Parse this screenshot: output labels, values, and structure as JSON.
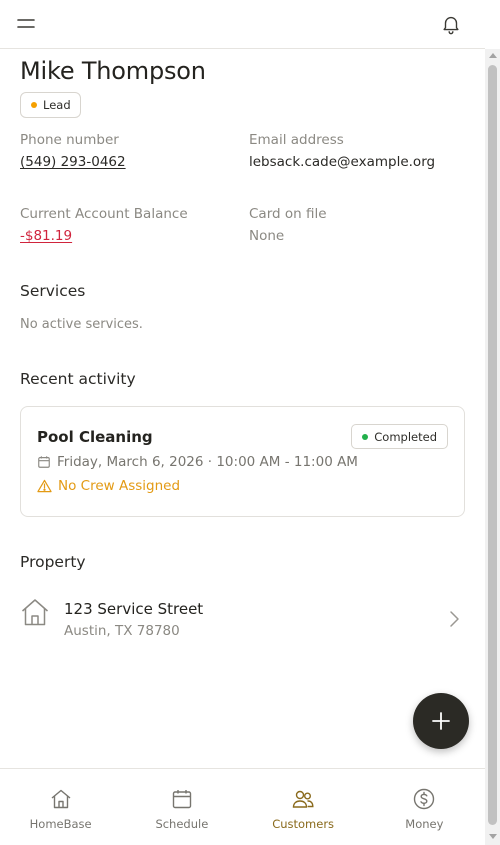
{
  "customer": {
    "name": "Mike Thompson",
    "status_badge": "Lead",
    "status_color": "#f5a000"
  },
  "fields": {
    "phone_label": "Phone number",
    "phone_value": "(549) 293-0462",
    "email_label": "Email address",
    "email_value": "lebsack.cade@example.org",
    "balance_label": "Current Account Balance",
    "balance_value": "-$81.19",
    "card_label": "Card on file",
    "card_value": "None"
  },
  "services": {
    "title": "Services",
    "empty_text": "No active services."
  },
  "activity": {
    "title": "Recent activity",
    "items": [
      {
        "title": "Pool Cleaning",
        "status": "Completed",
        "status_color": "#22b04b",
        "datetime": "Friday, March 6, 2026 · 10:00 AM - 11:00 AM",
        "warning": "No Crew Assigned",
        "warning_color": "#e39a14"
      }
    ]
  },
  "property": {
    "title": "Property",
    "street": "123 Service Street",
    "city": "Austin, TX 78780"
  },
  "nav": {
    "items": [
      {
        "label": "HomeBase",
        "icon": "home-icon",
        "active": false
      },
      {
        "label": "Schedule",
        "icon": "calendar-icon",
        "active": false
      },
      {
        "label": "Customers",
        "icon": "users-icon",
        "active": true
      },
      {
        "label": "Money",
        "icon": "dollar-circle-icon",
        "active": false
      }
    ]
  },
  "colors": {
    "accent": "#8a6a1c",
    "negative": "#d0243d",
    "fab": "#2b2a25"
  }
}
